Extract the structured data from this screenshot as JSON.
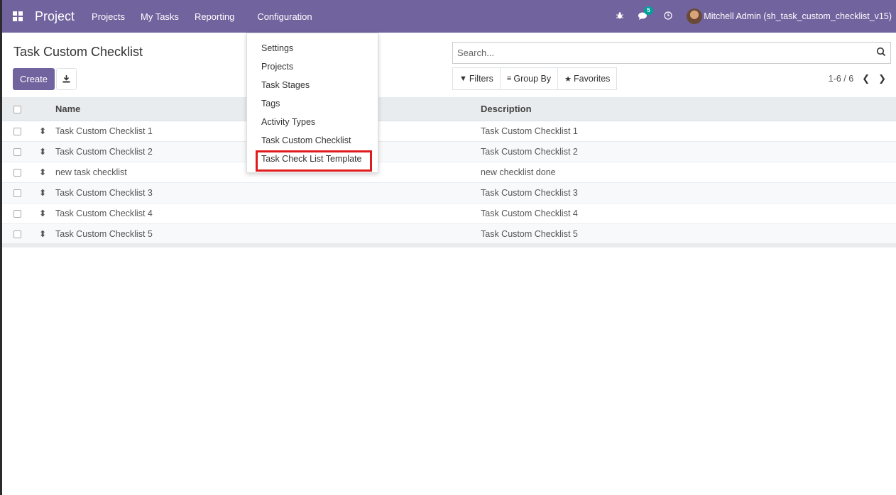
{
  "navbar": {
    "app_name": "Project",
    "menu": [
      "Projects",
      "My Tasks",
      "Reporting",
      "Configuration"
    ],
    "badge_count": "5",
    "user": "Mitchell Admin (sh_task_custom_checklist_v15)"
  },
  "control_panel": {
    "title": "Task Custom Checklist",
    "create_label": "Create",
    "search_placeholder": "Search...",
    "filters_label": "Filters",
    "group_by_label": "Group By",
    "favorites_label": "Favorites",
    "pager": "1-6 / 6"
  },
  "table": {
    "columns": [
      "Name",
      "Description"
    ],
    "rows": [
      {
        "name": "Task Custom Checklist 1",
        "description": "Task Custom Checklist 1"
      },
      {
        "name": "Task Custom Checklist 2",
        "description": "Task Custom Checklist 2"
      },
      {
        "name": "new task checklist",
        "description": "new checklist done"
      },
      {
        "name": "Task Custom Checklist 3",
        "description": "Task Custom Checklist 3"
      },
      {
        "name": "Task Custom Checklist 4",
        "description": "Task Custom Checklist 4"
      },
      {
        "name": "Task Custom Checklist 5",
        "description": "Task Custom Checklist 5"
      }
    ]
  },
  "config_dropdown": {
    "items": [
      "Settings",
      "Projects",
      "Task Stages",
      "Tags",
      "Activity Types",
      "Task Custom Checklist",
      "Task Check List Template"
    ],
    "highlighted_item": "Task Check List Template"
  },
  "colors": {
    "brand": "#71639e",
    "badge": "#00a09d",
    "highlight": "#e01b1b"
  }
}
